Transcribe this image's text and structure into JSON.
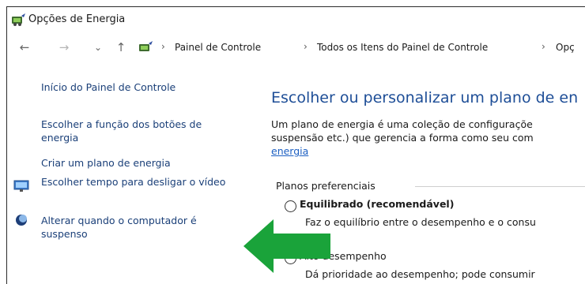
{
  "window": {
    "title": "Opções de Energia"
  },
  "address_bar": {
    "crumbs": [
      "Painel de Controle",
      "Todos os Itens do Painel de Controle",
      "Opç"
    ],
    "separator": "›"
  },
  "nav": {
    "back": "←",
    "forward": "→",
    "recent": "⌄",
    "up": "↑"
  },
  "sidebar": {
    "items": [
      {
        "label": "Início do Painel de Controle"
      },
      {
        "label": "Escolher a função dos botões de energia"
      },
      {
        "label": "Criar um plano de energia"
      },
      {
        "label": "Escolher tempo para desligar o vídeo"
      },
      {
        "label": "Alterar quando o computador é suspenso"
      }
    ]
  },
  "main": {
    "heading": "Escolher ou personalizar um plano de en",
    "description_line1": "Um plano de energia é uma coleção de configuraçõe",
    "description_line2": "suspensão etc.) que gerencia a forma como seu com",
    "description_link": "energia",
    "section_label": "Planos preferenciais",
    "plans": [
      {
        "name": "Equilibrado (recomendável)",
        "description": "Faz o equilíbrio entre o desempenho e o consu"
      },
      {
        "name": "Alto desempenho",
        "description": "Dá prioridade ao desempenho; pode consumir"
      }
    ]
  },
  "colors": {
    "heading": "#1e4e97",
    "link": "#1c5fc2",
    "annotation_arrow": "#1aa33a"
  }
}
